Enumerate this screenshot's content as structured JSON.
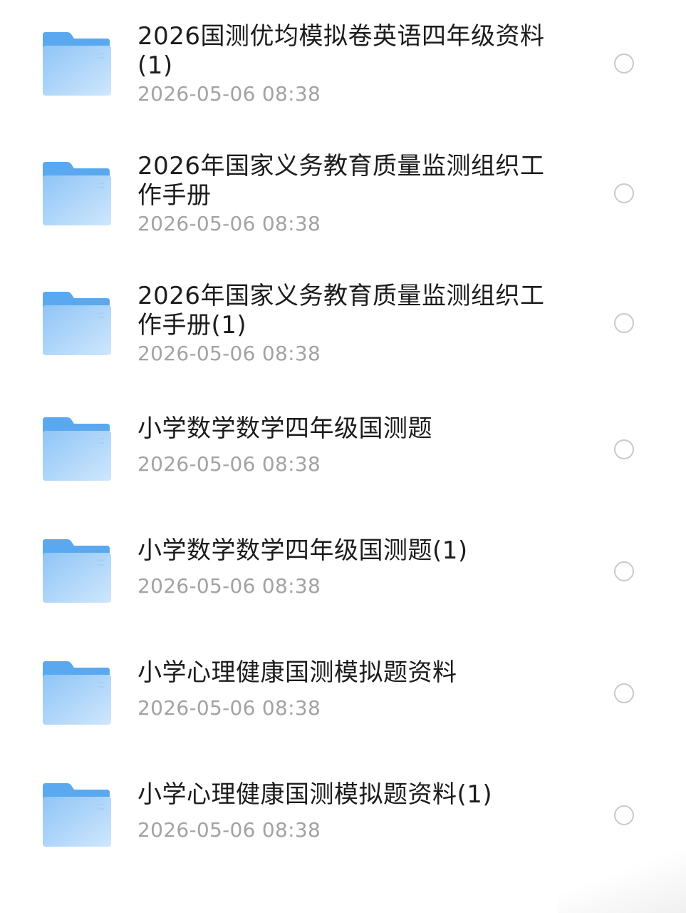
{
  "files": [
    {
      "name": "2026国测优均模拟卷英语四年级资料\n(1)",
      "time": "2026-05-06 08:38",
      "icon": "folder-icon"
    },
    {
      "name": "2026年国家义务教育质量监测组织工\n作手册",
      "time": "2026-05-06 08:38",
      "icon": "folder-icon"
    },
    {
      "name": "2026年国家义务教育质量监测组织工\n作手册(1)",
      "time": "2026-05-06 08:38",
      "icon": "folder-icon"
    },
    {
      "name": "小学数学数学四年级国测题",
      "time": "2026-05-06 08:38",
      "icon": "folder-icon"
    },
    {
      "name": "小学数学数学四年级国测题(1)",
      "time": "2026-05-06 08:38",
      "icon": "folder-icon"
    },
    {
      "name": "小学心理健康国测模拟题资料",
      "time": "2026-05-06 08:38",
      "icon": "folder-icon"
    },
    {
      "name": "小学心理健康国测模拟题资料(1)",
      "time": "2026-05-06 08:38",
      "icon": "folder-icon"
    }
  ],
  "colors": {
    "folder_back": "#5aa9f0",
    "folder_front_top": "#9ccdf8",
    "folder_front_bottom": "#c6e3fb",
    "name_text": "#1c1c1c",
    "time_text": "#a3a3a3",
    "circle_border": "#c9c9c9"
  }
}
